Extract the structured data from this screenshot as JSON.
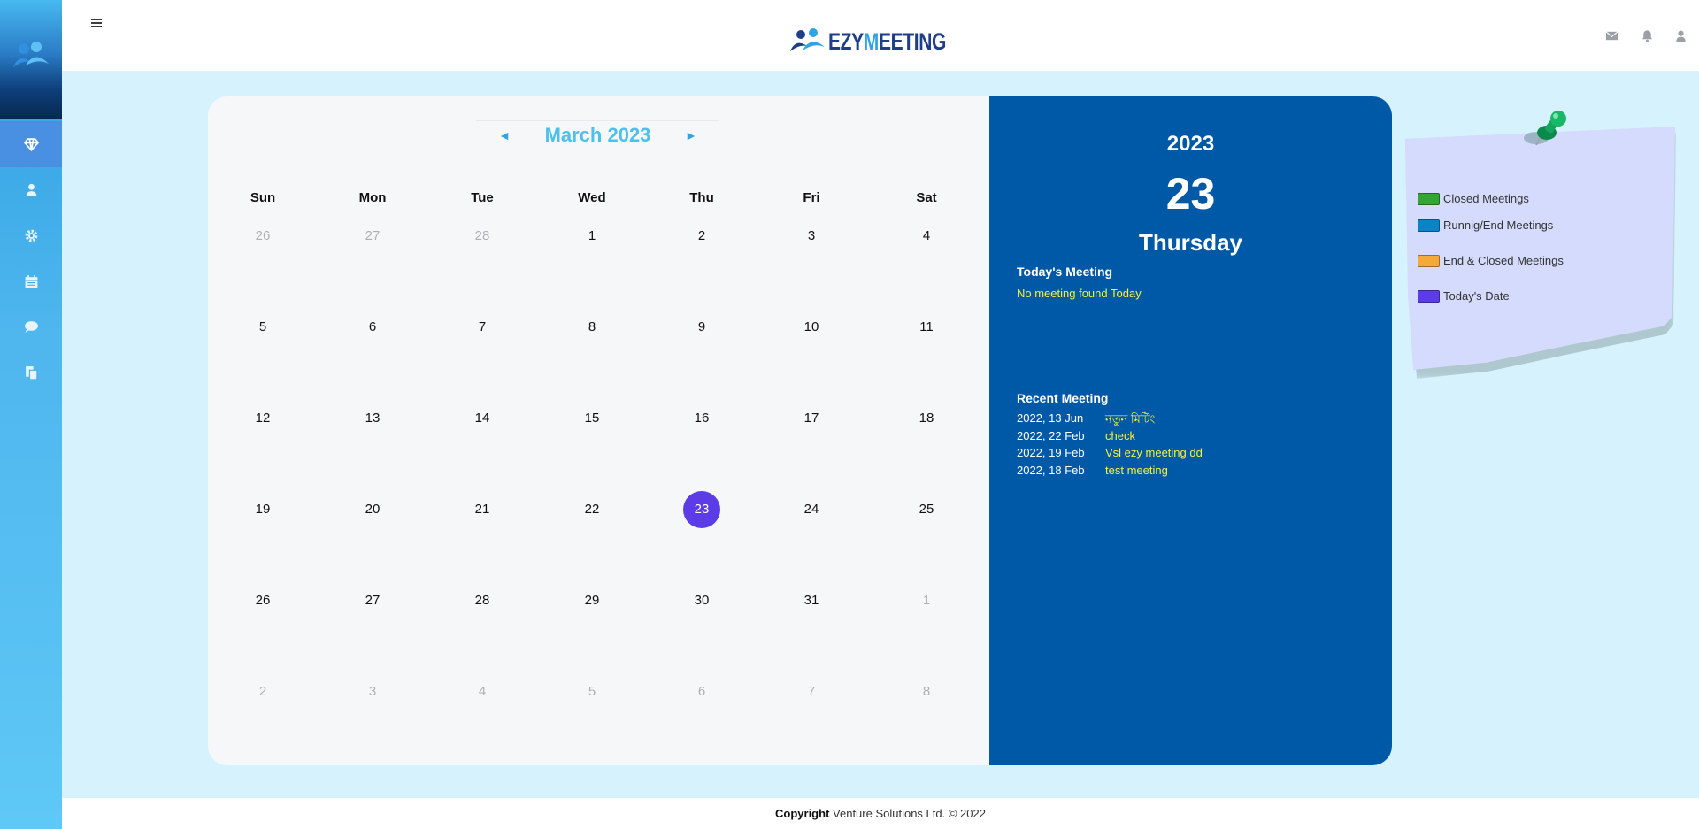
{
  "app": {
    "brand_prefix": "EZY",
    "brand_mid": "M",
    "brand_suffix": "EETING"
  },
  "sidebar": {
    "items": [
      {
        "name": "dashboard",
        "icon": "diamond-icon",
        "active": true
      },
      {
        "name": "profile",
        "icon": "user-icon"
      },
      {
        "name": "settings",
        "icon": "gear-icon"
      },
      {
        "name": "calendar",
        "icon": "calendar-icon"
      },
      {
        "name": "chat",
        "icon": "chat-icon"
      },
      {
        "name": "documents",
        "icon": "documents-icon"
      }
    ]
  },
  "header": {
    "icons": [
      "envelope-icon",
      "bell-icon",
      "user-icon"
    ]
  },
  "calendar": {
    "month_title": "March 2023",
    "prev_arrow": "◄",
    "next_arrow": "►",
    "weekdays": [
      "Sun",
      "Mon",
      "Tue",
      "Wed",
      "Thu",
      "Fri",
      "Sat"
    ],
    "weeks": [
      [
        {
          "d": "26",
          "m": true
        },
        {
          "d": "27",
          "m": true
        },
        {
          "d": "28",
          "m": true
        },
        {
          "d": "1"
        },
        {
          "d": "2"
        },
        {
          "d": "3"
        },
        {
          "d": "4"
        }
      ],
      [
        {
          "d": "5"
        },
        {
          "d": "6"
        },
        {
          "d": "7"
        },
        {
          "d": "8"
        },
        {
          "d": "9"
        },
        {
          "d": "10"
        },
        {
          "d": "11"
        }
      ],
      [
        {
          "d": "12"
        },
        {
          "d": "13"
        },
        {
          "d": "14"
        },
        {
          "d": "15"
        },
        {
          "d": "16"
        },
        {
          "d": "17"
        },
        {
          "d": "18"
        }
      ],
      [
        {
          "d": "19"
        },
        {
          "d": "20"
        },
        {
          "d": "21"
        },
        {
          "d": "22"
        },
        {
          "d": "23",
          "today": true
        },
        {
          "d": "24"
        },
        {
          "d": "25"
        }
      ],
      [
        {
          "d": "26"
        },
        {
          "d": "27"
        },
        {
          "d": "28"
        },
        {
          "d": "29"
        },
        {
          "d": "30"
        },
        {
          "d": "31"
        },
        {
          "d": "1",
          "m": true
        }
      ],
      [
        {
          "d": "2",
          "m": true
        },
        {
          "d": "3",
          "m": true
        },
        {
          "d": "4",
          "m": true
        },
        {
          "d": "5",
          "m": true
        },
        {
          "d": "6",
          "m": true
        },
        {
          "d": "7",
          "m": true
        },
        {
          "d": "8",
          "m": true
        }
      ]
    ],
    "today_color": "#5b3ce6"
  },
  "info": {
    "year": "2023",
    "day": "23",
    "weekday": "Thursday",
    "todays_meeting_title": "Today's Meeting",
    "no_meeting_text": "No meeting found Today",
    "recent_title": "Recent Meeting",
    "recent": [
      {
        "date": "2022, 13 Jun",
        "title": "নতুন মিটিং"
      },
      {
        "date": "2022, 22 Feb",
        "title": "check"
      },
      {
        "date": "2022, 19 Feb",
        "title": "Vsl ezy meeting dd"
      },
      {
        "date": "2022, 18 Feb",
        "title": "test meeting"
      }
    ]
  },
  "legend": {
    "items": [
      {
        "label": "Closed Meetings",
        "color": "#33a532"
      },
      {
        "label": "Runnig/End Meetings",
        "color": "#0a84c6"
      },
      {
        "label": "End & Closed Meetings",
        "color": "#f6a93b"
      },
      {
        "label": "Today's Date",
        "color": "#5b3ce6"
      }
    ]
  },
  "footer": {
    "copyright_label": "Copyright",
    "text": "Venture Solutions Ltd. © 2022"
  }
}
